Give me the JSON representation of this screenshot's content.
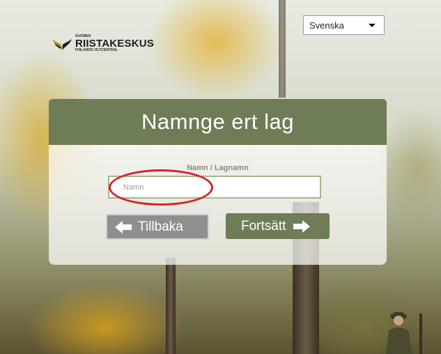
{
  "logo": {
    "top_text": "SUOMEN",
    "brand": "RIISTAKESKUS",
    "bottom_text": "FINLANDS VILTCENTRAL",
    "icon": "wing-logo-icon"
  },
  "language": {
    "selected": "Svenska",
    "icon": "chevron-down-icon"
  },
  "card": {
    "title": "Namnge ert lag",
    "field_label": "Namn / Lagnamn",
    "input": {
      "value": "",
      "placeholder": "Namn"
    },
    "back_button": "Tillbaka",
    "next_button": "Fortsätt"
  },
  "colors": {
    "header_green": "#6e7d55",
    "highlight_red": "#d4232a",
    "back_gray": "#8f8f8f"
  }
}
